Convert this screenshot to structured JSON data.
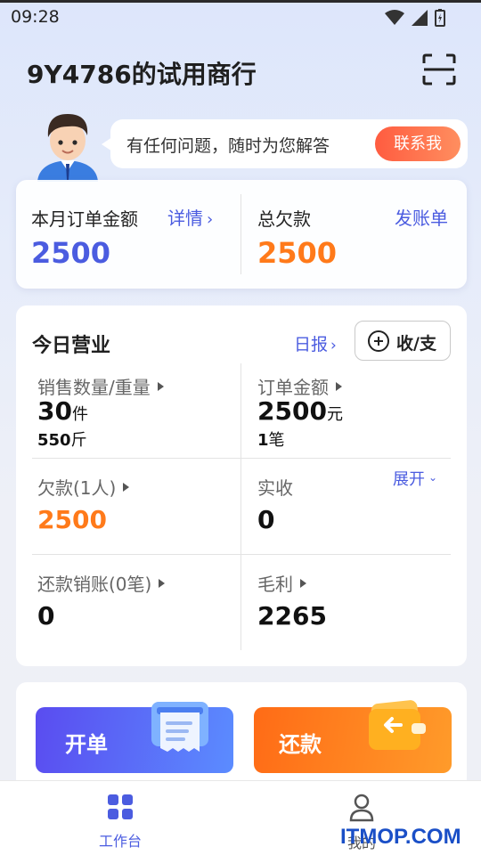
{
  "status_bar": {
    "time": "09:28"
  },
  "header": {
    "title": "9Y4786的试用商行"
  },
  "help": {
    "text": "有任何问题，随时为您解答",
    "contact_label": "联系我"
  },
  "summary": {
    "order_label": "本月订单金额",
    "order_link": "详情",
    "order_value": "2500",
    "debt_label": "总欠款",
    "debt_link": "发账单",
    "debt_value": "2500"
  },
  "today": {
    "title": "今日营业",
    "daily_link": "日报",
    "income_button": "收/支",
    "expand_link": "展开",
    "sales": {
      "label": "销售数量/重量",
      "value": "30",
      "unit": "件",
      "sub_value": "550",
      "sub_unit": "斤"
    },
    "order_amount": {
      "label": "订单金额",
      "value": "2500",
      "unit": "元",
      "sub_value": "1",
      "sub_unit": "笔"
    },
    "debt": {
      "label": "欠款(1人)",
      "value": "2500"
    },
    "received": {
      "label": "实收",
      "value": "0"
    },
    "repay": {
      "label": "还款销账(0笔)",
      "value": "0"
    },
    "profit": {
      "label": "毛利",
      "value": "2265"
    }
  },
  "actions": {
    "open_order": "开单",
    "repay": "还款"
  },
  "tabs": {
    "workbench": "工作台",
    "mine": "我的"
  },
  "watermark": "ITMOP.COM",
  "colors": {
    "accent_blue": "#4b5ce0",
    "accent_orange": "#ff7a1a",
    "contact_red": "#ff5c40"
  }
}
